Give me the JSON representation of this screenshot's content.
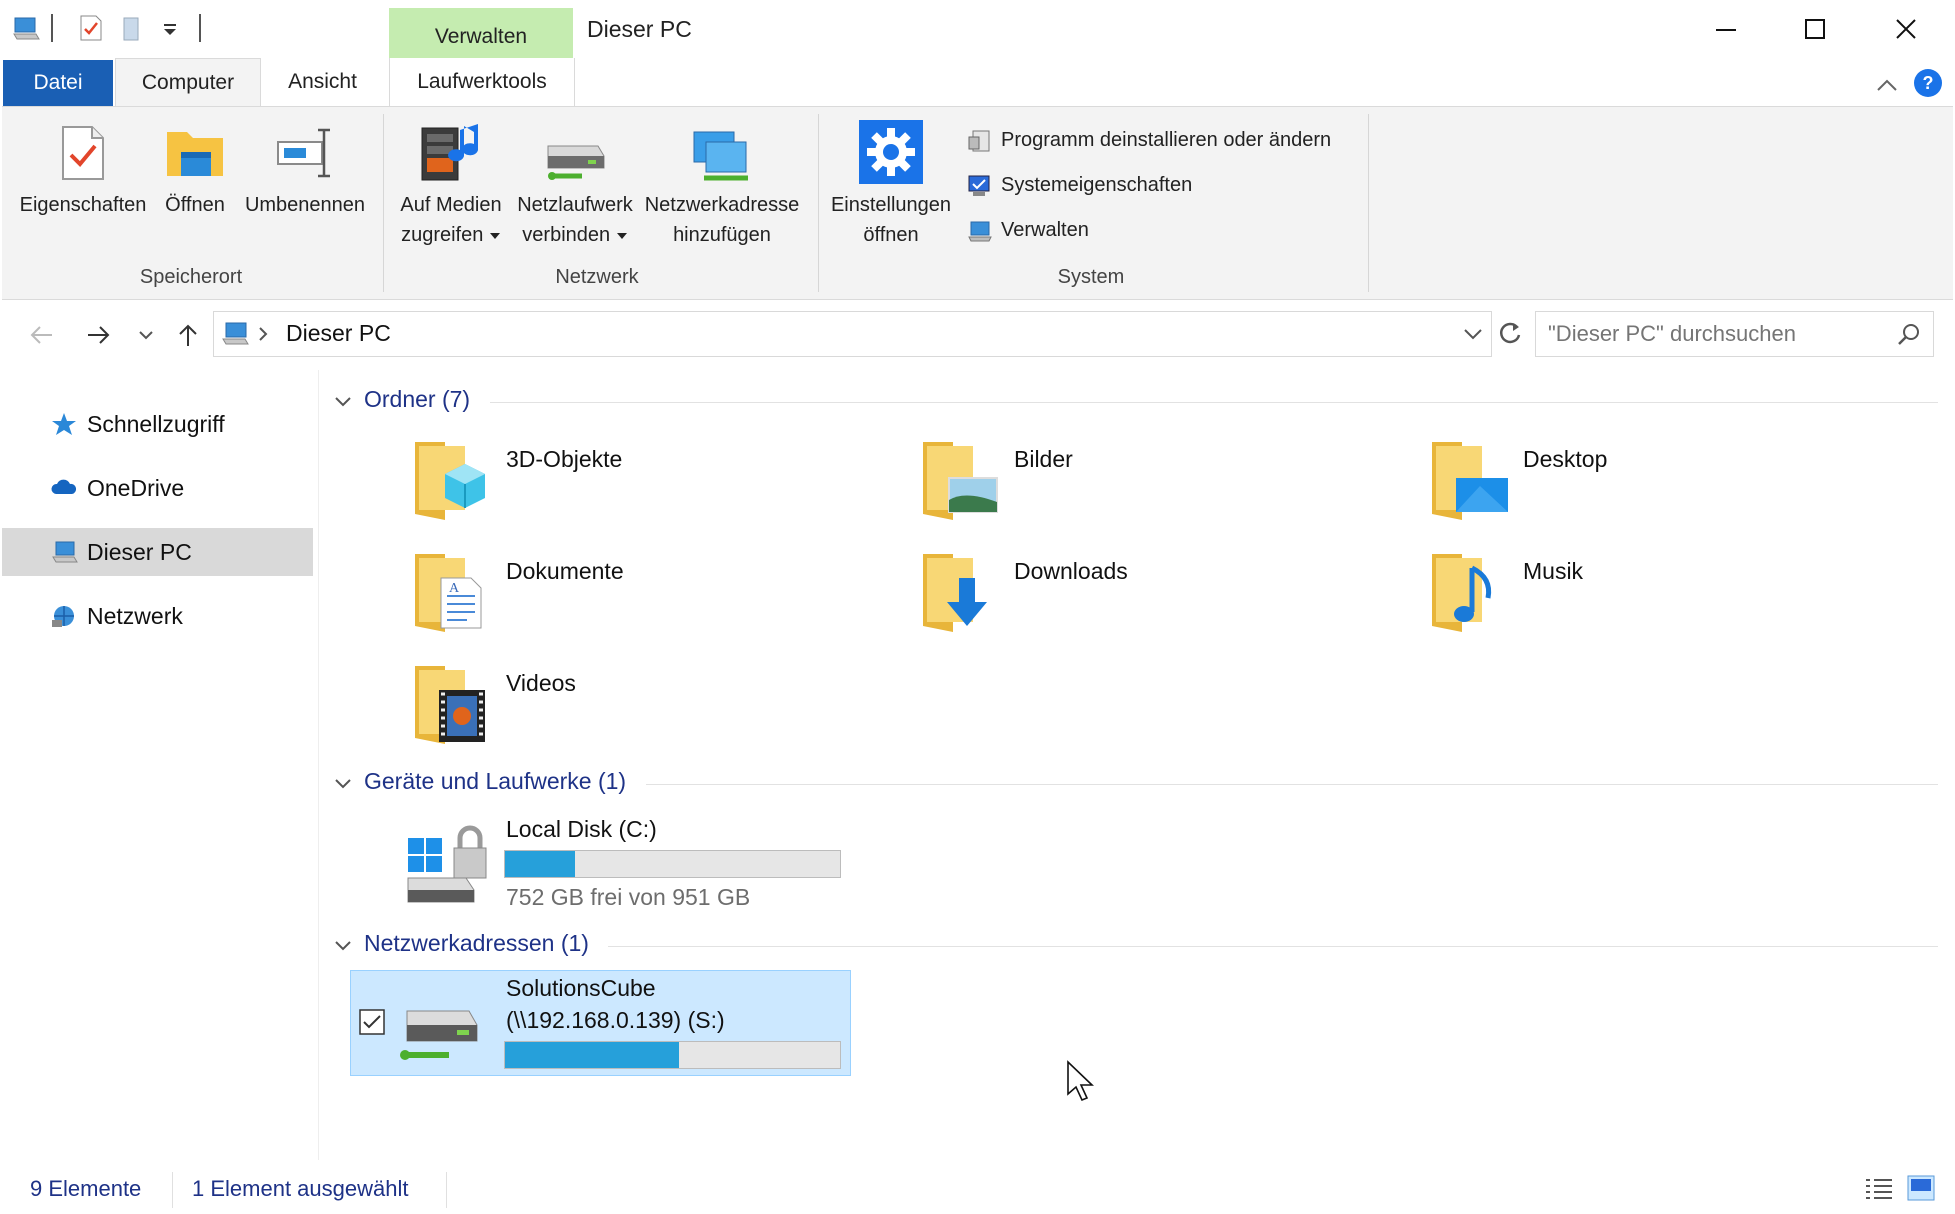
{
  "window": {
    "title": "Dieser PC",
    "contextual_tab_group": "Verwalten"
  },
  "ribbon": {
    "tabs": [
      "Datei",
      "Computer",
      "Ansicht",
      "Laufwerktools"
    ],
    "speicherort": {
      "label": "Speicherort",
      "eigenschaften": "Eigenschaften",
      "oeffnen": "Öffnen",
      "umbenennen": "Umbenennen"
    },
    "netzwerk": {
      "label": "Netzwerk",
      "medien_1": "Auf Medien",
      "medien_2": "zugreifen",
      "netzlaufwerk_1": "Netzlaufwerk",
      "netzlaufwerk_2": "verbinden",
      "netzwerkadresse_1": "Netzwerkadresse",
      "netzwerkadresse_2": "hinzufügen"
    },
    "system": {
      "label": "System",
      "einstellungen_1": "Einstellungen",
      "einstellungen_2": "öffnen",
      "programm": "Programm deinstallieren oder ändern",
      "systemeigenschaften": "Systemeigenschaften",
      "verwalten": "Verwalten"
    }
  },
  "address": {
    "path": "Dieser PC",
    "search_placeholder": "\"Dieser PC\" durchsuchen"
  },
  "nav": {
    "items": [
      {
        "label": "Schnellzugriff",
        "icon": "star-icon"
      },
      {
        "label": "OneDrive",
        "icon": "cloud-icon"
      },
      {
        "label": "Dieser PC",
        "icon": "computer-icon",
        "selected": true
      },
      {
        "label": "Netzwerk",
        "icon": "network-icon"
      }
    ]
  },
  "content": {
    "folders_header": "Ordner (7)",
    "folders": [
      "3D-Objekte",
      "Bilder",
      "Desktop",
      "Dokumente",
      "Downloads",
      "Musik",
      "Videos"
    ],
    "devices_header": "Geräte und Laufwerke (1)",
    "local_disk": {
      "name": "Local Disk (C:)",
      "free_text": "752 GB frei von 951 GB",
      "used_fraction": 0.21
    },
    "network_header": "Netzwerkadressen (1)",
    "network_drive": {
      "name_1": "SolutionsCube",
      "name_2": "(\\\\192.168.0.139) (S:)",
      "used_fraction": 0.52,
      "selected": true
    }
  },
  "status": {
    "count": "9 Elemente",
    "selection": "1 Element ausgewählt"
  },
  "colors": {
    "accent": "#1a5fb4",
    "bar_fill": "#26a0da",
    "selection": "#cce8ff",
    "contextual_tab": "#c5ecb0",
    "group_header": "#1e3287"
  }
}
